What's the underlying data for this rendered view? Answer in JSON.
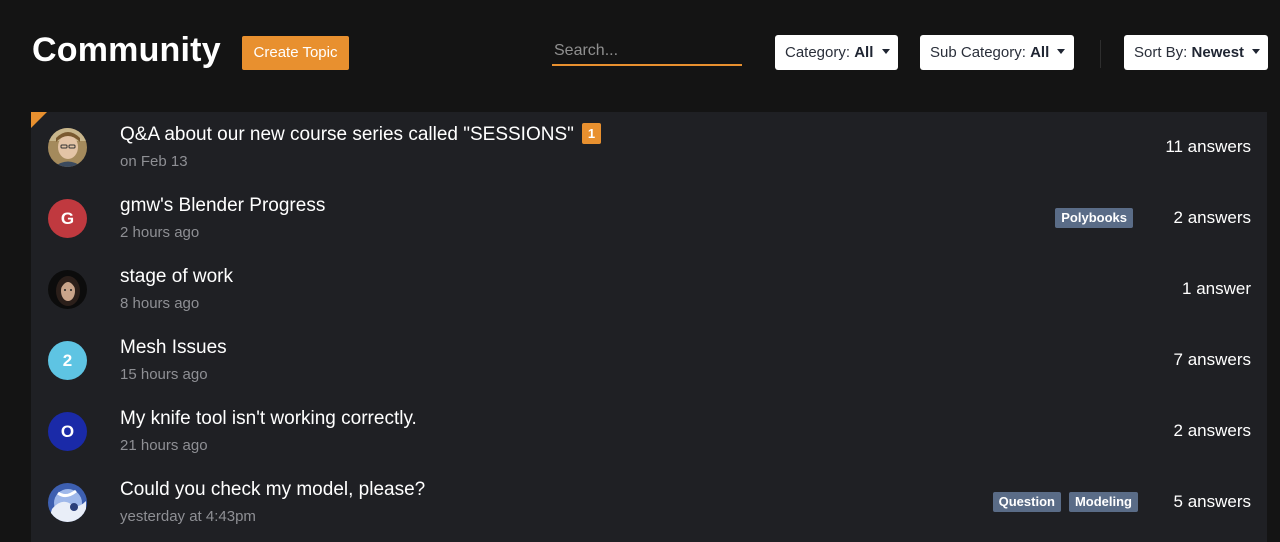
{
  "header": {
    "title": "Community",
    "create_label": "Create Topic",
    "search_placeholder": "Search...",
    "category": {
      "label": "Category:",
      "value": "All"
    },
    "sub_category": {
      "label": "Sub Category:",
      "value": "All"
    },
    "sort": {
      "label": "Sort By:",
      "value": "Newest"
    }
  },
  "colors": {
    "accent": "#e8902f",
    "background": "#141414",
    "list_background": "#1f2024",
    "tag": "#5a6c87"
  },
  "topics": [
    {
      "title": "Q&A about our new course series called \"SESSIONS\"",
      "badge": "1",
      "time": "on Feb 13",
      "answers": "11 answers",
      "avatar": {
        "type": "photo",
        "letter": "",
        "color": "#b9a27a"
      },
      "tags": []
    },
    {
      "title": "gmw's Blender Progress",
      "badge": "",
      "time": "2 hours ago",
      "answers": "2 answers",
      "avatar": {
        "type": "letter",
        "letter": "G",
        "color": "#c0393f"
      },
      "tags": [
        "Polybooks"
      ]
    },
    {
      "title": "stage of work",
      "badge": "",
      "time": "8 hours ago",
      "answers": "1 answer",
      "avatar": {
        "type": "photo",
        "letter": "",
        "color": "#3a2e28"
      },
      "tags": []
    },
    {
      "title": "Mesh Issues",
      "badge": "",
      "time": "15 hours ago",
      "answers": "7 answers",
      "avatar": {
        "type": "letter",
        "letter": "2",
        "color": "#5ec4e3"
      },
      "tags": []
    },
    {
      "title": "My knife tool isn't working correctly.",
      "badge": "",
      "time": "21 hours ago",
      "answers": "2 answers",
      "avatar": {
        "type": "letter",
        "letter": "O",
        "color": "#1a2aa8"
      },
      "tags": []
    },
    {
      "title": "Could you check my model, please?",
      "badge": "",
      "time": "yesterday at 4:43pm",
      "answers": "5 answers",
      "avatar": {
        "type": "photo",
        "letter": "",
        "color": "#6f8fd6"
      },
      "tags": [
        "Question",
        "Modeling"
      ]
    }
  ]
}
